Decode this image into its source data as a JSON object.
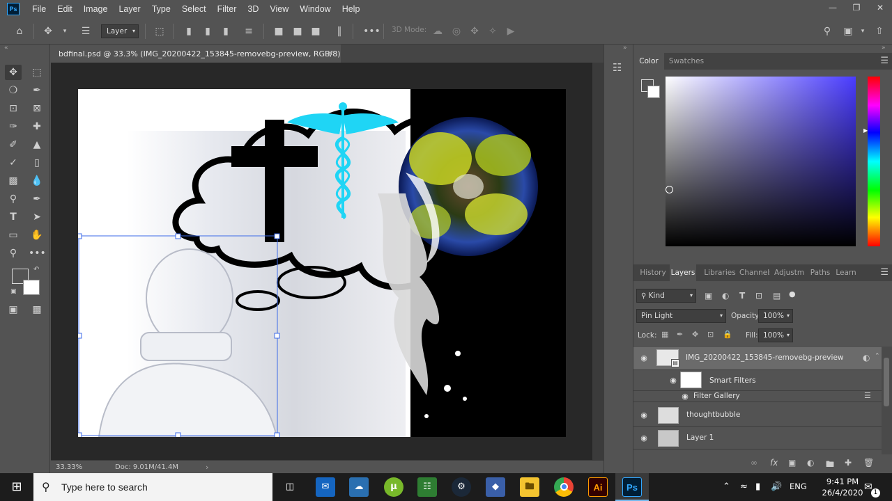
{
  "app": {
    "logo": "Ps",
    "menus": [
      "File",
      "Edit",
      "Image",
      "Layer",
      "Type",
      "Select",
      "Filter",
      "3D",
      "View",
      "Window",
      "Help"
    ],
    "window_controls": [
      "minimize-icon",
      "restore-icon",
      "close-icon"
    ]
  },
  "options_bar": {
    "auto_select_target": "Layer",
    "mode_3d_label": "3D Mode:",
    "icons": [
      "home-icon",
      "move-icon",
      "layer-stack-icon",
      "transform-controls-icon",
      "align-left-icon",
      "align-center-h-icon",
      "align-right-icon",
      "distribute-h-icon",
      "align-top-icon",
      "align-middle-v-icon",
      "align-bottom-icon",
      "distribute-v-icon",
      "more-icon",
      "orbit-3d-icon",
      "roll-3d-icon",
      "pan-3d-icon",
      "slide-3d-icon",
      "scale-3d-icon",
      "search-icon",
      "workspace-icon",
      "share-icon"
    ]
  },
  "document": {
    "tab_title": "bdfinal.psd @ 33.3% (IMG_20200422_153845-removebg-preview, RGB/8)",
    "zoom": "33.33%",
    "doc_size": "Doc: 9.01M/41.4M"
  },
  "color_panel": {
    "tabs": [
      "Color",
      "Swatches"
    ],
    "active_tab": "Color",
    "picker_hue": "#4a3cff",
    "foreground": "#535353",
    "background": "#ffffff"
  },
  "layers_panel": {
    "tabs": [
      "History",
      "Layers",
      "Libraries",
      "Channels",
      "Adjustm",
      "Paths",
      "Learn"
    ],
    "active_tab": "Layers",
    "filter_kind": "Kind",
    "blend_mode": "Pin Light",
    "opacity_label": "Opacity:",
    "opacity": "100%",
    "lock_label": "Lock:",
    "fill_label": "Fill:",
    "fill": "100%",
    "layers": [
      {
        "name": "IMG_20200422_153845-removebg-preview",
        "selected": true
      },
      {
        "name": "Smart Filters",
        "sub": true
      },
      {
        "name": "Filter Gallery",
        "sub": true
      },
      {
        "name": "thoughtbubble"
      },
      {
        "name": "Layer 1"
      }
    ]
  },
  "taskbar": {
    "search_placeholder": "Type here to search",
    "apps": [
      "task-view-icon",
      "outlook-icon",
      "network-app-icon",
      "utorrent-icon",
      "shop-icon",
      "steam-icon",
      "app-diamond-icon",
      "file-explorer-icon",
      "chrome-icon",
      "illustrator-icon",
      "photoshop-icon"
    ],
    "illustrator_label": "Ai",
    "photoshop_label": "Ps",
    "language": "ENG",
    "time": "9:41 PM",
    "date": "26/4/2020",
    "notification_count": "1"
  }
}
